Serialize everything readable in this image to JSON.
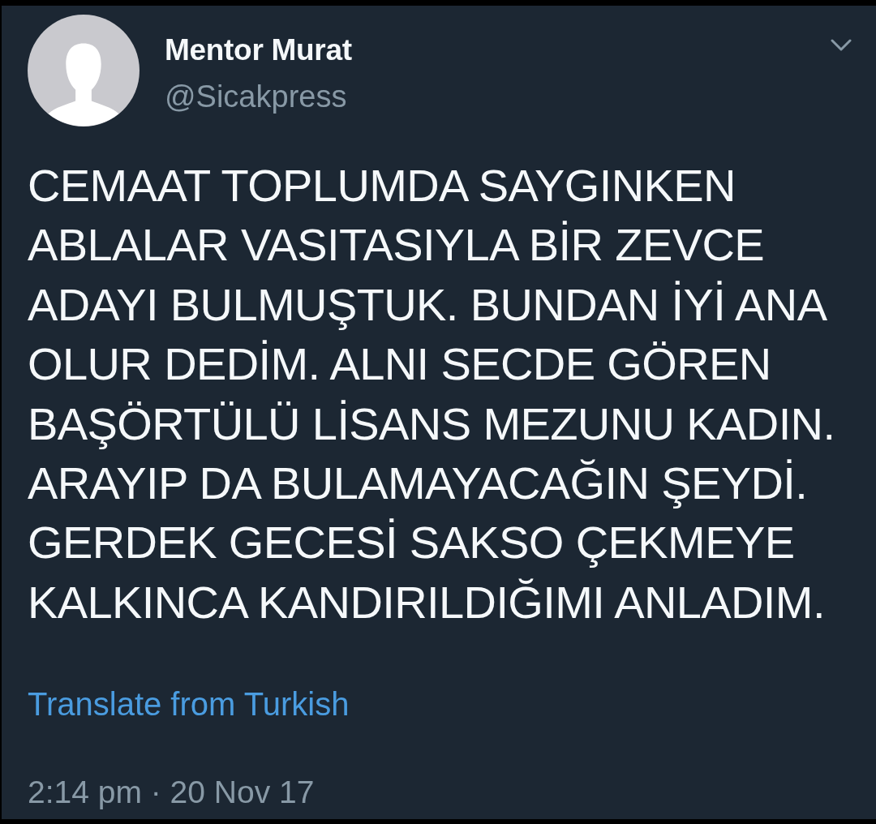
{
  "tweet": {
    "author": {
      "name": "Mentor Murat",
      "handle": "@Sicakpress"
    },
    "text": "CEMAAT TOPLUMDA SAYGINKEN ABLALAR VASITASIYLA BİR ZEVCE ADAYI BULMUŞTUK. BUNDAN İYİ ANA OLUR DEDİM. ALNI SECDE GÖREN BAŞÖRTÜLÜ LİSANS MEZUNU KADIN. ARAYIP DA BULAMAYACAĞIN ŞEYDİ. GERDEK GECESİ SAKSO ÇEKMEYE KALKINCA KANDIRILDIĞIMI ANLADIM.",
    "translate_link": "Translate from Turkish",
    "timestamp": "2:14 pm · 20 Nov 17"
  }
}
